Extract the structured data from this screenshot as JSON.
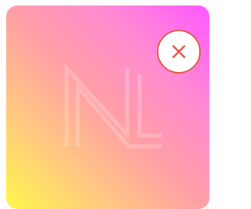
{
  "card": {
    "logo_text": "NL",
    "close_icon": "close-icon",
    "colors": {
      "gradient_top_right": "#ff58ff",
      "gradient_bottom_left": "#fff64c",
      "close_accent": "#e06050",
      "close_background": "#ffffff"
    }
  }
}
